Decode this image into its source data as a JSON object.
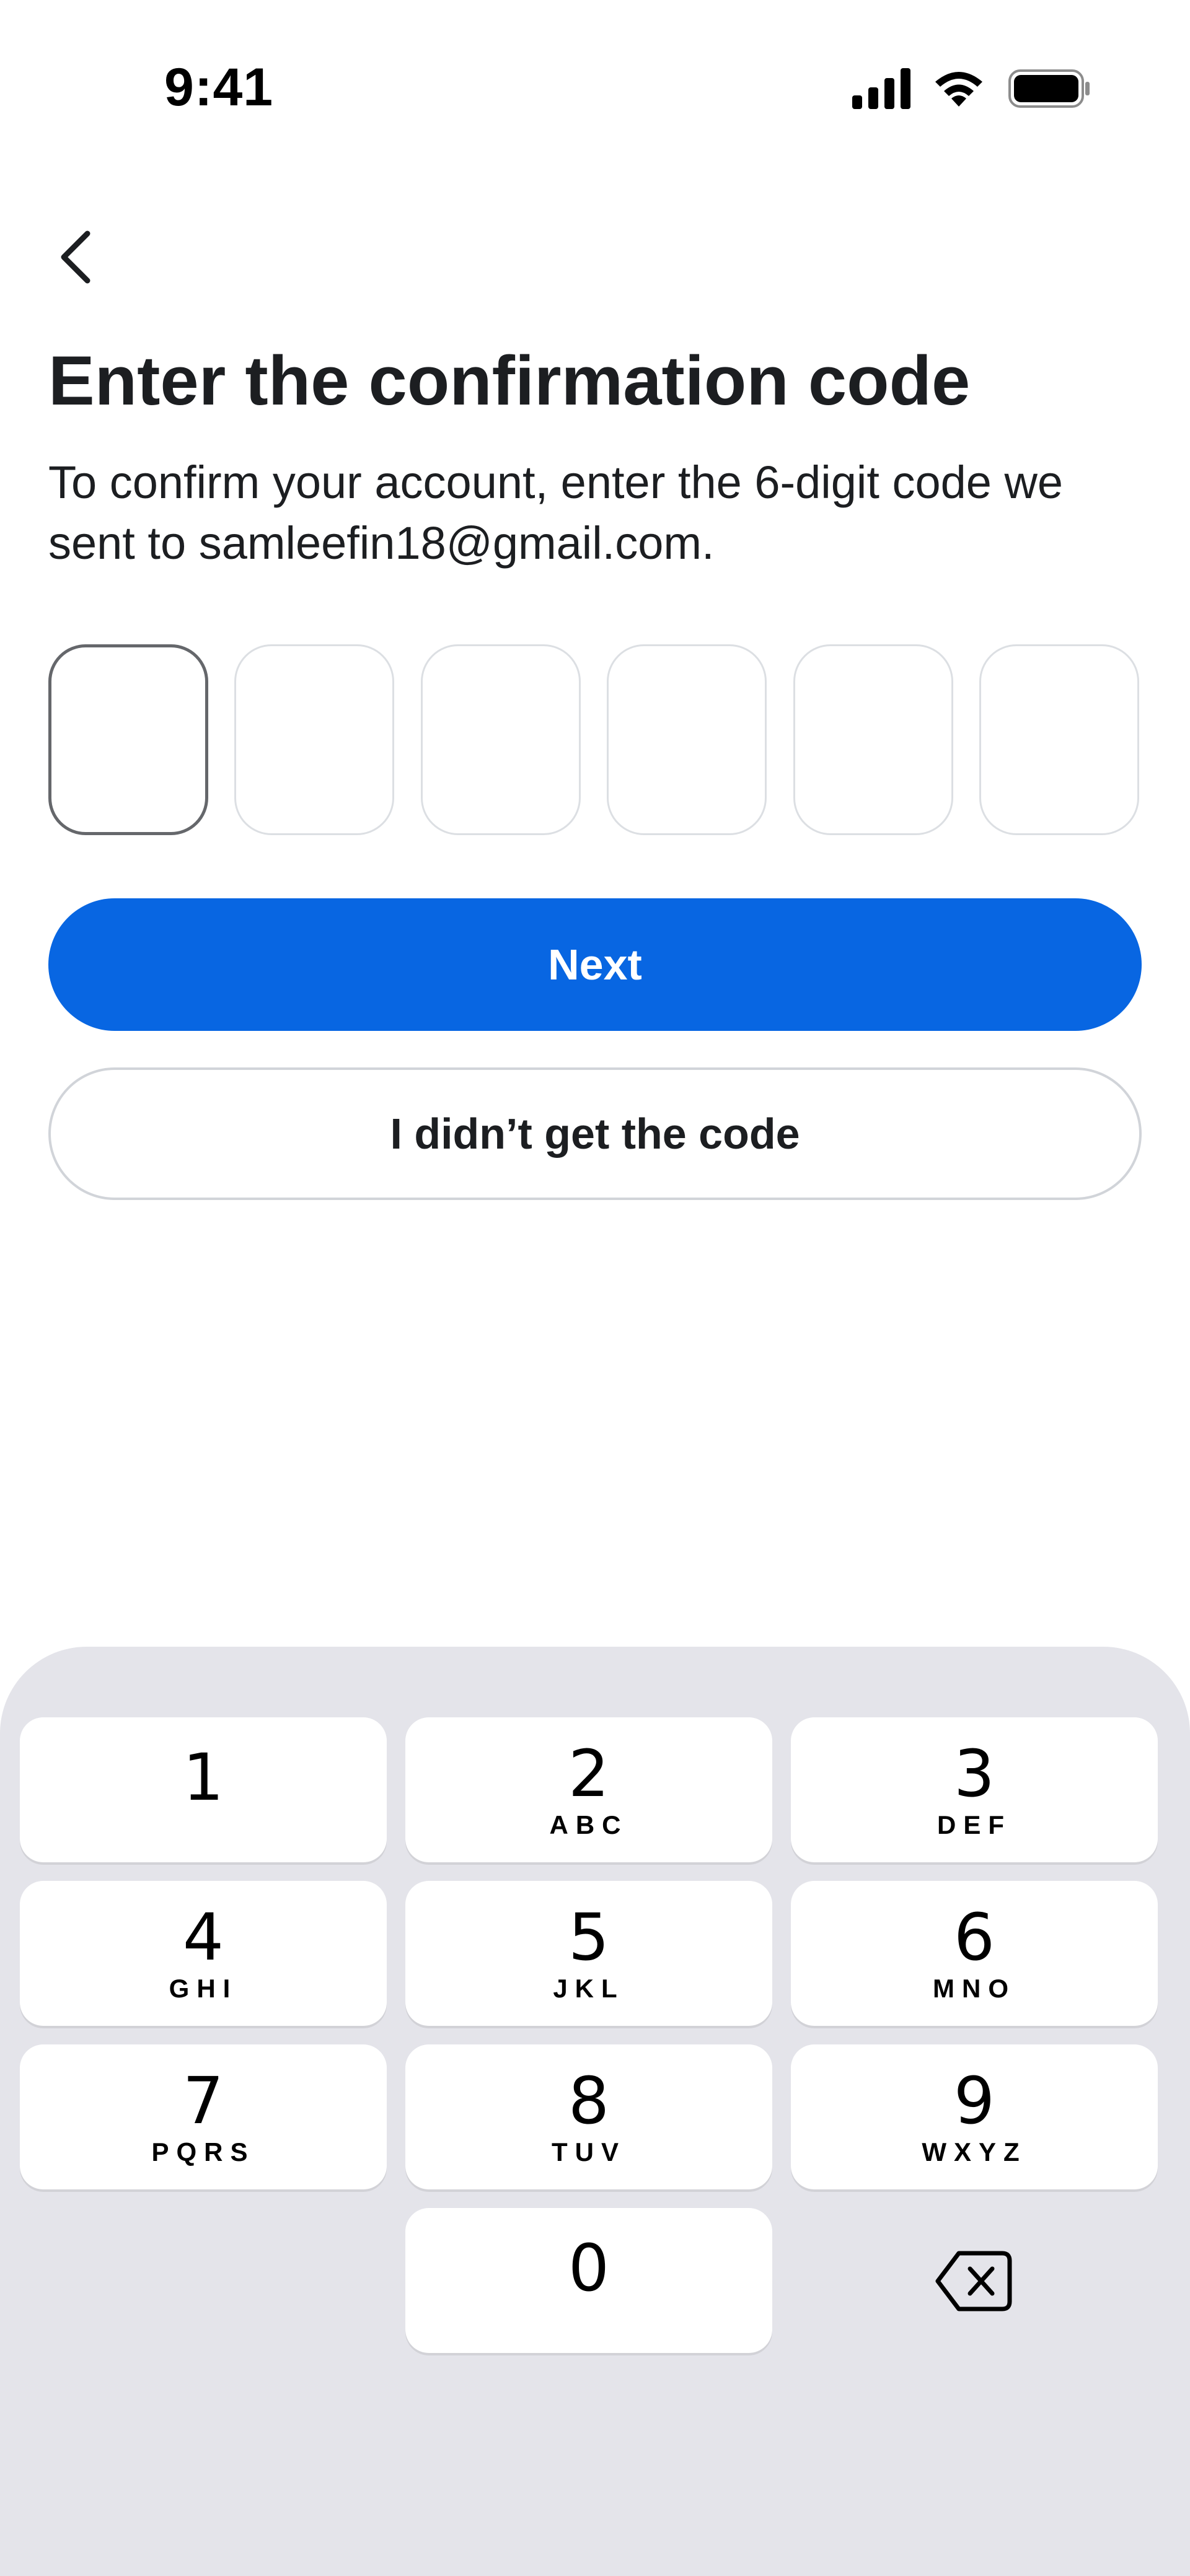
{
  "status_bar": {
    "time": "9:41",
    "signal_icon": "cellular-signal-icon",
    "wifi_icon": "wifi-icon",
    "battery_icon": "battery-icon"
  },
  "nav": {
    "back_icon": "chevron-left-icon"
  },
  "header": {
    "title": "Enter the confirmation code",
    "subtitle": "To confirm your account, enter the 6-digit code we sent to samleefin18@gmail.com."
  },
  "code_input": {
    "boxes": [
      "",
      "",
      "",
      "",
      "",
      ""
    ],
    "active_index": 0
  },
  "actions": {
    "next_label": "Next",
    "resend_label": "I didn’t get the code"
  },
  "keypad": {
    "keys": [
      {
        "num": "1",
        "letters": ""
      },
      {
        "num": "2",
        "letters": "ABC"
      },
      {
        "num": "3",
        "letters": "DEF"
      },
      {
        "num": "4",
        "letters": "GHI"
      },
      {
        "num": "5",
        "letters": "JKL"
      },
      {
        "num": "6",
        "letters": "MNO"
      },
      {
        "num": "7",
        "letters": "PQRS"
      },
      {
        "num": "8",
        "letters": "TUV"
      },
      {
        "num": "9",
        "letters": "WXYZ"
      },
      {
        "num": "0",
        "letters": ""
      }
    ],
    "delete_icon": "backspace-icon"
  },
  "colors": {
    "primary": "#0866e2",
    "keyboard_bg": "#e4e4ea",
    "text": "#1c1e21",
    "box_border": "#dcdfe3",
    "active_box_border": "#65676b"
  }
}
